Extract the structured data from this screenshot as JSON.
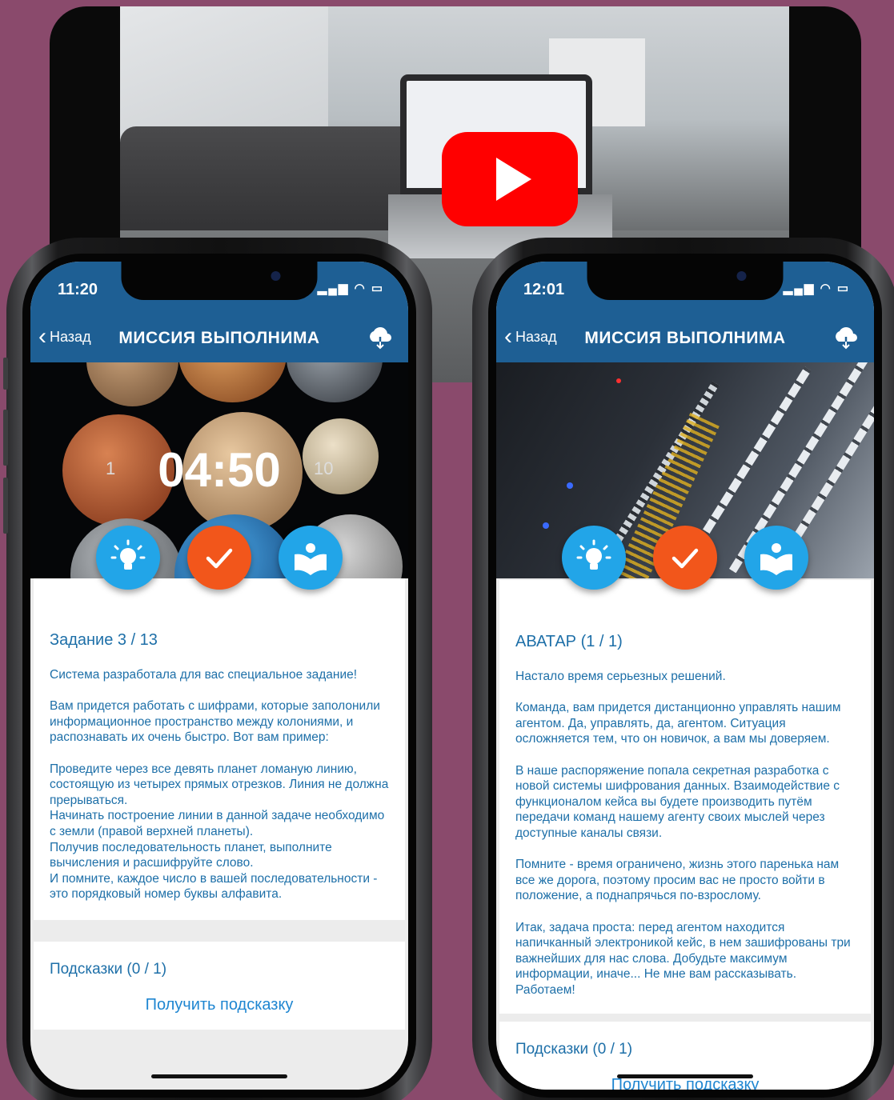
{
  "video": {
    "play_icon": "youtube-play-icon"
  },
  "phones": [
    {
      "status_time": "11:20",
      "back_label": "Назад",
      "title": "МИССИЯ ВЫПОЛНИМА",
      "timer": "04:50",
      "left_num": "1",
      "right_num": "10",
      "task_heading": "Задание 3 / 13",
      "paragraphs": [
        "Система разработала для вас специальное задание!",
        "Вам придется работать с шифрами, которые заполонили информационное пространство между колониями, и распознавать их очень быстро. Вот вам пример:",
        "Проведите через все девять планет ломаную линию, состоящую из четырех прямых отрезков. Линия не должна прерываться.\nНачинать построение линии в данной задаче необходимо с земли (правой верхней планеты).\nПолучив последовательность планет, выполните вычисления и расшифруйте слово.\nИ помните, каждое число в вашей последовательности - это порядковый номер буквы алфавита."
      ],
      "hints_label": "Подсказки (0 / 1)",
      "get_hint_label": "Получить подсказку"
    },
    {
      "status_time": "12:01",
      "back_label": "Назад",
      "title": "МИССИЯ ВЫПОЛНИМА",
      "task_heading": "АВАТАР (1 / 1)",
      "paragraphs": [
        "Настало время серьезных решений.",
        "Команда, вам придется дистанционно управлять нашим агентом. Да, управлять, да, агентом. Ситуация осложняется тем, что он новичок, а вам мы доверяем.",
        "В наше распоряжение попала секретная разработка с новой системы шифрования данных. Взаимодействие с функционалом кейса вы будете производить путём передачи команд нашему агенту своих мыслей через доступные каналы связи.",
        "Помните - время ограничено, жизнь этого паренька нам все же дорога, поэтому просим вас не просто войти в положение, а поднапрячься по-взрослому.",
        "Итак, задача проста: перед агентом находится напичканный электроникой кейс, в нем зашифрованы три важнейших для нас слова. Добудьте максимум информации, иначе... Не мне вам рассказывать. Работаем!"
      ],
      "hints_label": "Подсказки (0 / 1)",
      "get_hint_label": "Получить подсказку"
    }
  ],
  "colors": {
    "nav": "#1e5f94",
    "accent_blue": "#22a5e8",
    "accent_orange": "#f2561b",
    "text_blue": "#1d6fa8",
    "background": "#8a4a6c"
  }
}
